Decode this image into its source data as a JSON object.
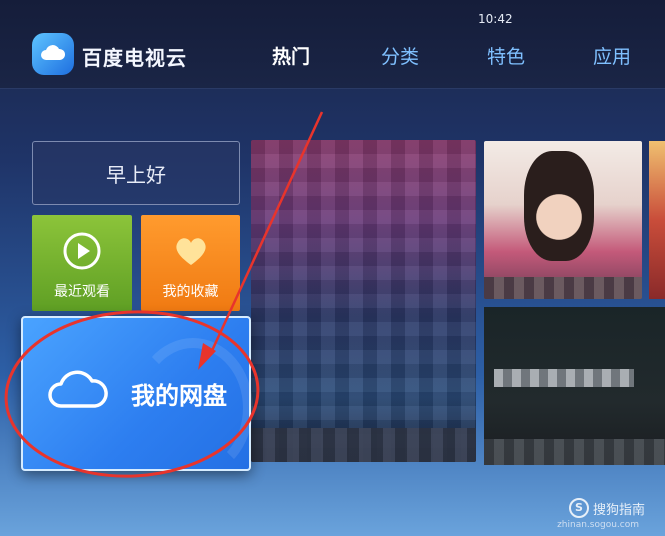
{
  "status": {
    "time": "10:42"
  },
  "brand": {
    "name": "百度电视云",
    "logo": "cloud-logo-icon",
    "accent": "#2d7ef0"
  },
  "nav": {
    "tabs": [
      "热门",
      "分类",
      "特色",
      "应用"
    ],
    "active": 0
  },
  "tiles": {
    "greeting": "早上好",
    "recent": {
      "label": "最近观看",
      "icon": "play-icon",
      "color": "#7bb632"
    },
    "favorites": {
      "label": "我的收藏",
      "icon": "heart-icon",
      "color": "#f58a1f"
    },
    "cloud_disk": {
      "label": "我的网盘",
      "icon": "cloud-icon",
      "color": "#2d7ef0"
    }
  },
  "annotation": {
    "color": "#e8342c"
  },
  "watermark": {
    "text": "搜狗指南",
    "sub": "zhinan.sogou.com"
  }
}
